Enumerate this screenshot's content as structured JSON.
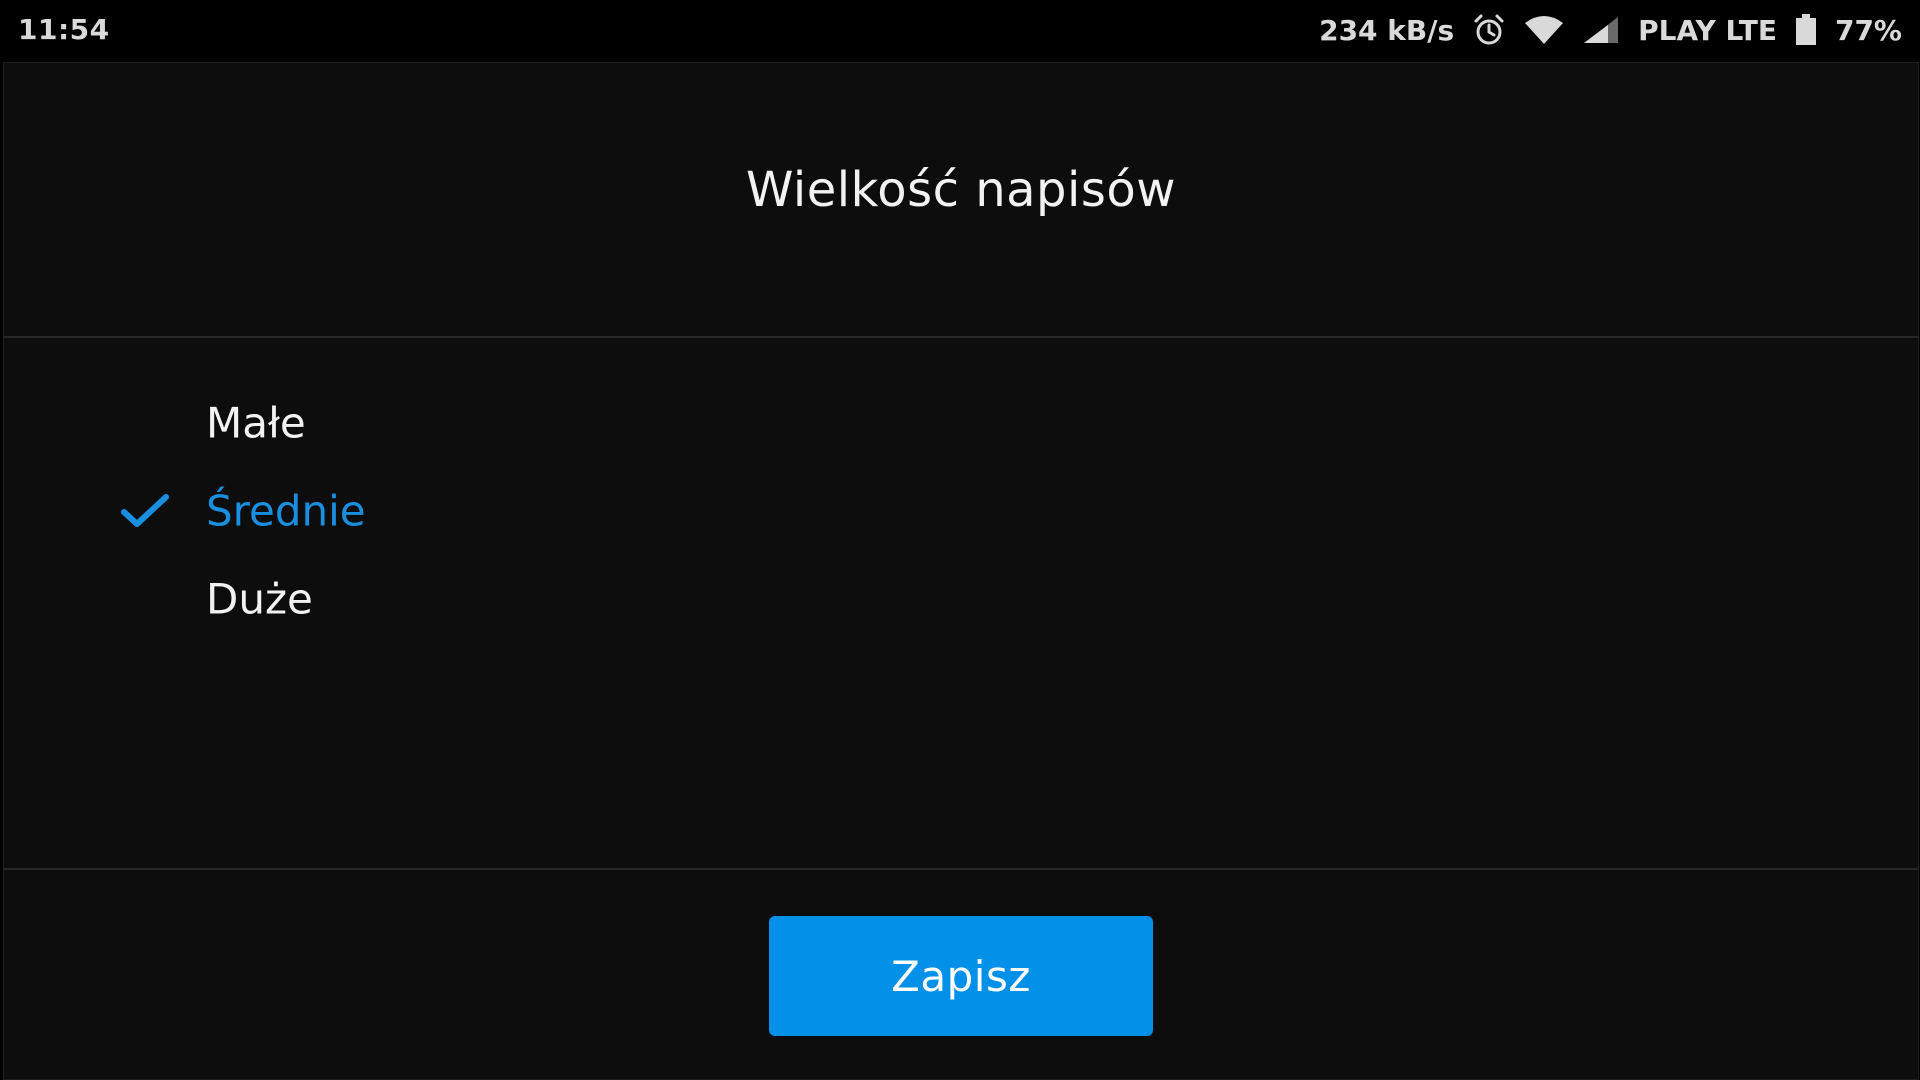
{
  "status_bar": {
    "time": "11:54",
    "network_speed": "234 kB/s",
    "carrier": "PLAY LTE",
    "battery": "77%",
    "icons": [
      "alarm-icon",
      "wifi-icon",
      "signal-icon",
      "battery-icon"
    ]
  },
  "dialog": {
    "title": "Wielkość napisów",
    "options": [
      {
        "label": "Małe",
        "selected": false
      },
      {
        "label": "Średnie",
        "selected": true
      },
      {
        "label": "Duże",
        "selected": false
      }
    ],
    "save_label": "Zapisz"
  },
  "colors": {
    "accent": "#0290e8",
    "selected_text": "#1a8fe0",
    "background": "#0d0d0d"
  }
}
